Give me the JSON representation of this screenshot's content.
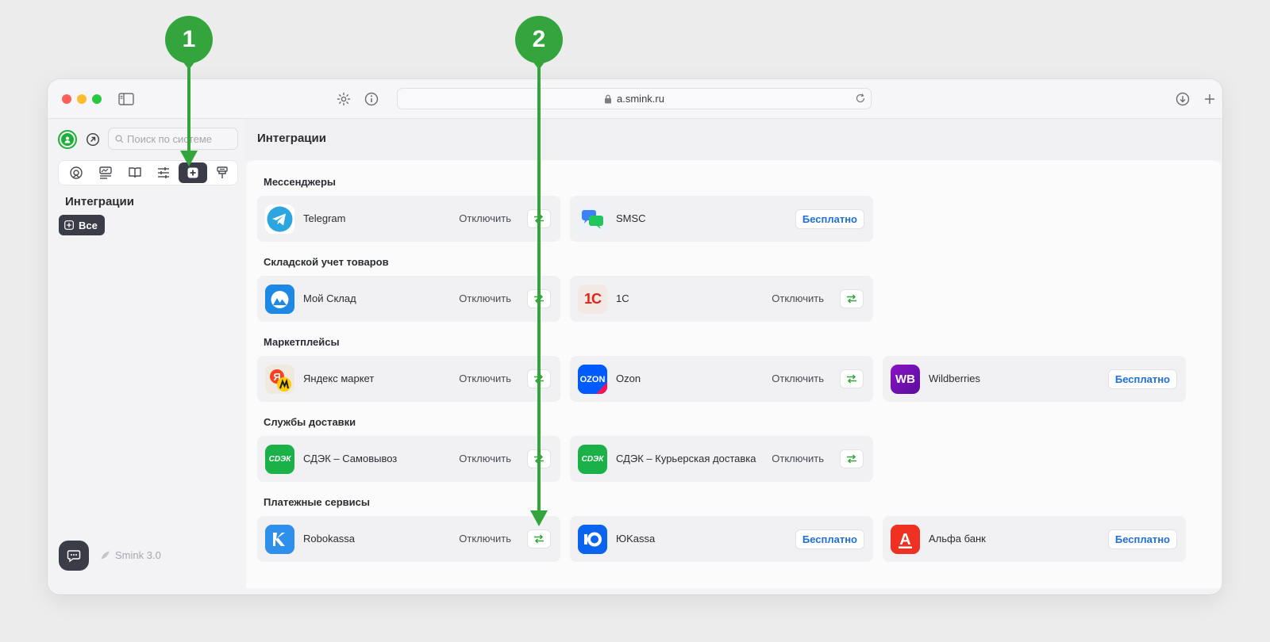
{
  "browser": {
    "url": "a.smink.ru"
  },
  "sidebar": {
    "search_placeholder": "Поиск по системе",
    "title": "Интеграции",
    "all_button": "Все",
    "version": "Smink 3.0"
  },
  "page": {
    "title": "Интеграции"
  },
  "sections": [
    {
      "title": "Мессенджеры"
    },
    {
      "title": "Складской учет товаров"
    },
    {
      "title": "Маркетплейсы"
    },
    {
      "title": "Службы доставки"
    },
    {
      "title": "Платежные сервисы"
    }
  ],
  "cards": [
    {
      "name": "Telegram",
      "action": "Отключить"
    },
    {
      "name": "SMSC",
      "action": "Бесплатно"
    },
    {
      "name": "Мой Склад",
      "action": "Отключить"
    },
    {
      "name": "1С",
      "action": "Отключить",
      "logo_text": "1С"
    },
    {
      "name": "Яндекс маркет",
      "action": "Отключить",
      "logo_text": "Я"
    },
    {
      "name": "Ozon",
      "action": "Отключить",
      "logo_text": "OZON"
    },
    {
      "name": "Wildberries",
      "action": "Бесплатно",
      "logo_text": "WB"
    },
    {
      "name": "СДЭК – Самовывоз",
      "action": "Отключить",
      "logo_text": "СDЭК"
    },
    {
      "name": "СДЭК – Курьерская доставка",
      "action": "Отключить",
      "logo_text": "СDЭК"
    },
    {
      "name": "Robokassa",
      "action": "Отключить"
    },
    {
      "name": "ЮKassa",
      "action": "Бесплатно"
    },
    {
      "name": "Альфа банк",
      "action": "Бесплатно",
      "logo_text": "А"
    }
  ],
  "markers": [
    {
      "label": "1"
    },
    {
      "label": "2"
    }
  ],
  "colors": {
    "accent_green": "#34a53c",
    "dark": "#3a3d47",
    "link_blue": "#1f6fd6"
  }
}
